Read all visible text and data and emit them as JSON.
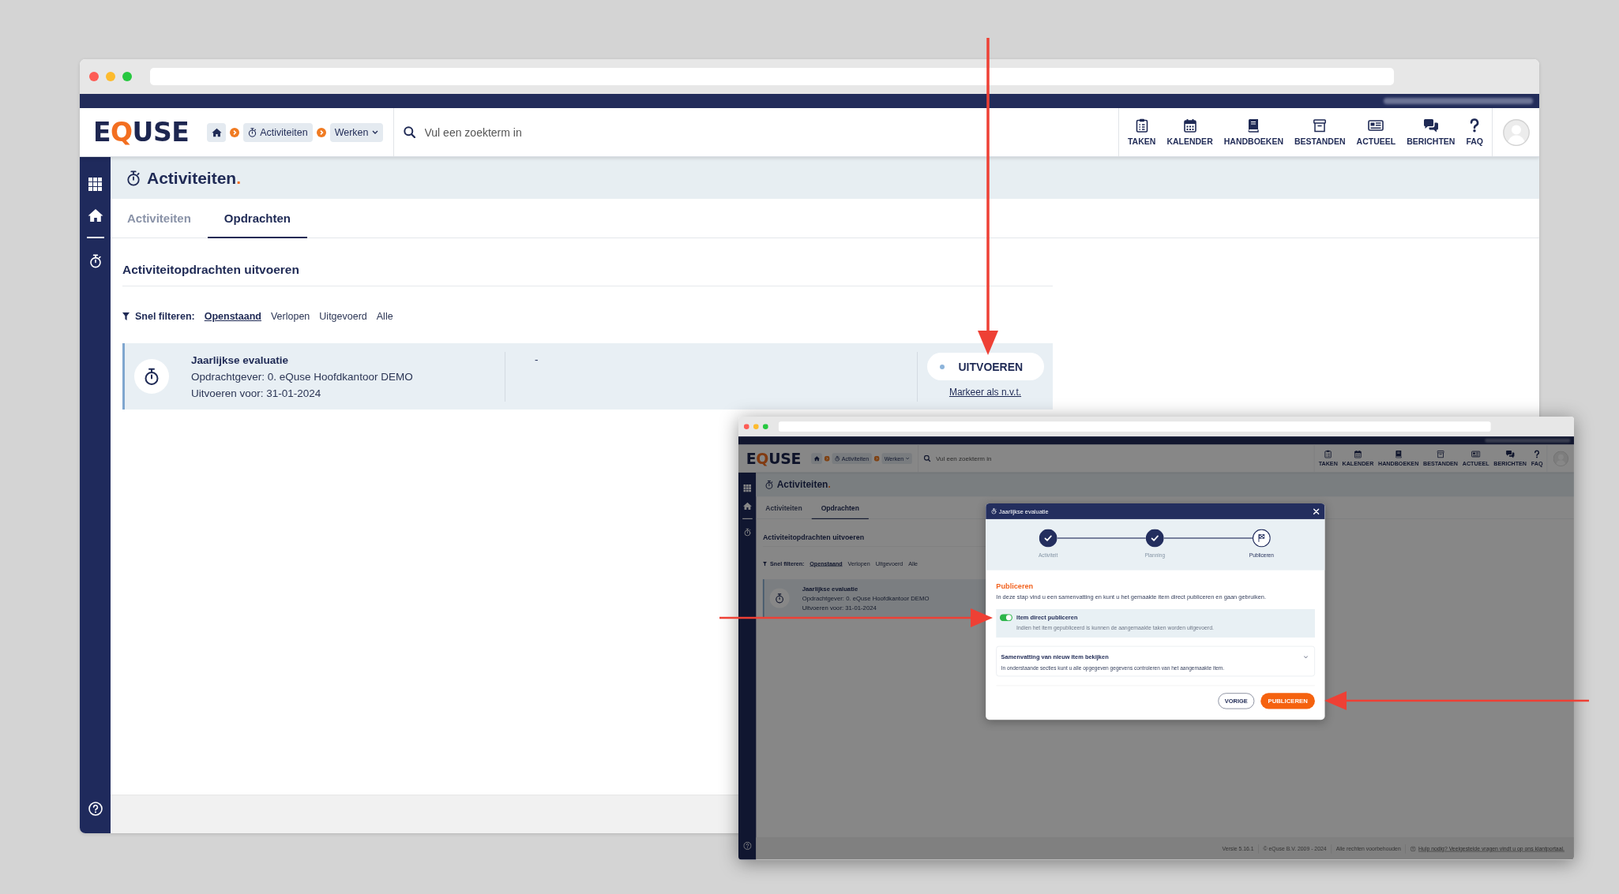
{
  "main": {
    "logo": {
      "before": "E",
      "accent": "Q",
      "after": "USE"
    },
    "breadcrumb": [
      {
        "kind": "home"
      },
      {
        "kind": "page",
        "label": "Activiteiten"
      },
      {
        "kind": "menu",
        "label": "Werken"
      }
    ],
    "search": {
      "placeholder": "Vul een zoekterm in"
    },
    "nav": [
      {
        "kind": "tasks",
        "label": "TAKEN"
      },
      {
        "kind": "calendar",
        "label": "KALENDER"
      },
      {
        "kind": "books",
        "label": "HANDBOEKEN"
      },
      {
        "kind": "files",
        "label": "BESTANDEN"
      },
      {
        "kind": "news",
        "label": "ACTUEEL"
      },
      {
        "kind": "messages",
        "label": "BERICHTEN"
      },
      {
        "kind": "faq",
        "label": "FAQ"
      }
    ],
    "page_title": {
      "text": "Activiteiten",
      "accent": "."
    },
    "tabs": [
      {
        "label": "Activiteiten",
        "selected": false
      },
      {
        "label": "Opdrachten",
        "selected": true
      }
    ],
    "section_title": "Activiteitopdrachten uitvoeren",
    "filters": {
      "label": "Snel filteren:",
      "options": [
        {
          "label": "Openstaand",
          "selected": true
        },
        {
          "label": "Verlopen",
          "selected": false
        },
        {
          "label": "Uitgevoerd",
          "selected": false
        },
        {
          "label": "Alle",
          "selected": false
        }
      ]
    },
    "assignments": [
      {
        "title": "Jaarlijkse evaluatie",
        "client": "Opdrachtgever: 0. eQuse Hoofdkantoor DEMO",
        "due": "Uitvoeren voor: 31-01-2024",
        "note": "-",
        "action": "UITVOEREN",
        "secondary_action": "Markeer als n.v.t."
      }
    ]
  },
  "inset": {
    "logo": {
      "before": "E",
      "accent": "Q",
      "after": "USE"
    },
    "breadcrumb": [
      {
        "kind": "home"
      },
      {
        "kind": "page",
        "label": "Activiteiten"
      },
      {
        "kind": "menu",
        "label": "Werken"
      }
    ],
    "search": {
      "placeholder": "Vul een zoekterm in"
    },
    "nav": [
      {
        "kind": "tasks",
        "label": "TAKEN"
      },
      {
        "kind": "calendar",
        "label": "KALENDER"
      },
      {
        "kind": "books",
        "label": "HANDBOEKEN"
      },
      {
        "kind": "files",
        "label": "BESTANDEN"
      },
      {
        "kind": "news",
        "label": "ACTUEEL"
      },
      {
        "kind": "messages",
        "label": "BERICHTEN"
      },
      {
        "kind": "faq",
        "label": "FAQ"
      }
    ],
    "page_title": {
      "text": "Activiteiten",
      "accent": "."
    },
    "tabs": [
      {
        "label": "Activiteiten",
        "selected": false
      },
      {
        "label": "Opdrachten",
        "selected": true
      }
    ],
    "section_title": "Activiteitopdrachten uitvoeren",
    "filters": {
      "label": "Snel filteren:",
      "options": [
        {
          "label": "Openstaand",
          "selected": true
        },
        {
          "label": "Verlopen",
          "selected": false
        },
        {
          "label": "Uitgevoerd",
          "selected": false
        },
        {
          "label": "Alle",
          "selected": false
        }
      ]
    },
    "assignments": [
      {
        "title": "Jaarlijkse evaluatie",
        "client": "Opdrachtgever: 0. eQuse Hoofdkantoor DEMO",
        "due": "Uitvoeren voor: 31-01-2024"
      }
    ],
    "footer": {
      "notes": [
        "Versie 5.16.1",
        "© eQuse B.V. 2009 - 2024",
        "Alle rechten voorbehouden"
      ],
      "help_link": "Hulp nodig? Veelgestelde vragen vindt u op ons klantportaal."
    },
    "dialog": {
      "title": "Jaarlijkse evaluatie",
      "steps": [
        {
          "label": "Activiteit",
          "done": true,
          "selected": false
        },
        {
          "label": "Planning",
          "done": true,
          "selected": false
        },
        {
          "label": "Publiceren",
          "done": false,
          "selected": true
        }
      ],
      "heading": "Publiceren",
      "description": "In deze stap vind u een samenvatting en kunt u het gemaakte item direct publiceren en gaan gebruiken.",
      "toggle": {
        "label": "Item direct publiceren",
        "hint": "Indien het item gepubliceerd is kunnen de aangemaakte taken worden uitgevoerd.",
        "on": true
      },
      "summary": {
        "title": "Samenvatting van nieuw item bekijken",
        "text": "In onderstaande secties kunt u alle opgegeven gegevens controleren van het aangemaakte item.",
        "expanded": false
      },
      "buttons": [
        {
          "kind": "secondary",
          "label": "VORIGE"
        },
        {
          "kind": "primary",
          "label": "PUBLICEREN"
        }
      ]
    }
  }
}
